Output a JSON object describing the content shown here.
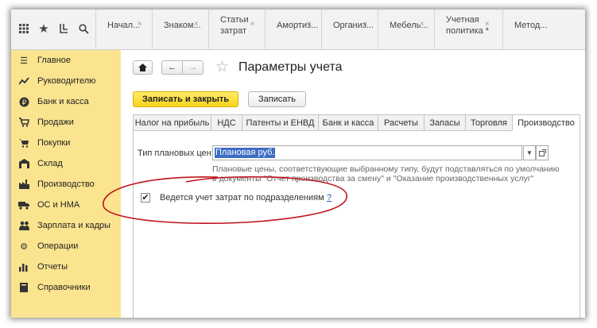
{
  "topbar": {
    "icons": [
      "grid-icon",
      "star-icon",
      "history-icon",
      "search-icon"
    ],
    "open_tabs": [
      {
        "label": "Начал..."
      },
      {
        "label": "Знаком..."
      },
      {
        "label": "Статьи затрат"
      },
      {
        "label": "Амортиз..."
      },
      {
        "label": "Организ..."
      },
      {
        "label": "Мебель..."
      },
      {
        "label": "Учетная политика *"
      },
      {
        "label": "Метод..."
      }
    ]
  },
  "sidebar": {
    "items": [
      {
        "label": "Главное",
        "icon": "menu-icon"
      },
      {
        "label": "Руководителю",
        "icon": "trend-icon"
      },
      {
        "label": "Банк и касса",
        "icon": "ruble-icon"
      },
      {
        "label": "Продажи",
        "icon": "cart-icon"
      },
      {
        "label": "Покупки",
        "icon": "basket-icon"
      },
      {
        "label": "Склад",
        "icon": "warehouse-icon"
      },
      {
        "label": "Производство",
        "icon": "factory-icon"
      },
      {
        "label": "ОС и НМА",
        "icon": "truck-icon"
      },
      {
        "label": "Зарплата и кадры",
        "icon": "people-icon"
      },
      {
        "label": "Операции",
        "icon": "gear-icon"
      },
      {
        "label": "Отчеты",
        "icon": "bar-chart-icon"
      },
      {
        "label": "Справочники",
        "icon": "book-icon"
      }
    ]
  },
  "header": {
    "title": "Параметры учета"
  },
  "toolbar": {
    "save_close_label": "Записать и закрыть",
    "save_label": "Записать"
  },
  "tabs": [
    {
      "label": "Налог на прибыль"
    },
    {
      "label": "НДС"
    },
    {
      "label": "Патенты и ЕНВД"
    },
    {
      "label": "Банк и касса"
    },
    {
      "label": "Расчеты"
    },
    {
      "label": "Запасы"
    },
    {
      "label": "Торговля"
    },
    {
      "label": "Производство"
    }
  ],
  "form": {
    "price_type_label": "Тип плановых цен:",
    "price_type_value": "Плановая руб.",
    "hint": "Плановые цены, соответствующие выбранному типу, будут подставляться по умолчанию в документы \"Отчет производства за смену\" и \"Оказание производственных услуг\"",
    "checkbox_label": "Ведется учет затрат по подразделениям",
    "checkbox_checked": true,
    "help_label": "?"
  },
  "colors": {
    "sidebar_bg": "#fbe48f",
    "primary_button": "#f7d31b",
    "selection": "#3d6dc4",
    "annotation": "#c0131d"
  }
}
